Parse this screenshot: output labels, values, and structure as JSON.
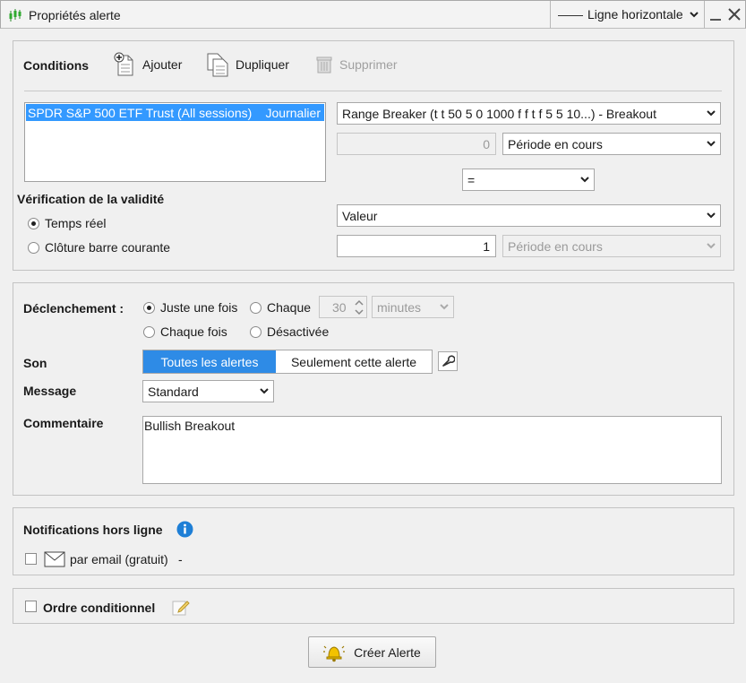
{
  "window": {
    "title": "Propriétés alerte",
    "line_type": "Ligne horizontale"
  },
  "conditions": {
    "heading": "Conditions",
    "toolbar": {
      "add": "Ajouter",
      "duplicate": "Dupliquer",
      "delete": "Supprimer"
    },
    "symbol_list": [
      {
        "name": "SPDR S&P 500 ETF Trust (All sessions)",
        "period": "Journalier"
      }
    ],
    "indicator": "Range Breaker (t t 50 5 0 1000 f f t f 5 5 10...)  - Breakout",
    "offset_value": "0",
    "period_1": "Période en cours",
    "operator": "=",
    "compare_to": "Valeur",
    "compare_value": "1",
    "period_2": "Période en cours",
    "validity": {
      "heading": "Vérification de la validité",
      "realtime": "Temps réel",
      "bar_close": "Clôture barre courante",
      "selected": "realtime"
    }
  },
  "trigger": {
    "label": "Déclenchement :",
    "once": "Juste une fois",
    "every": "Chaque",
    "interval_value": "30",
    "interval_unit": "minutes",
    "each_time": "Chaque fois",
    "disabled": "Désactivée",
    "selected": "once"
  },
  "sound": {
    "label": "Son",
    "all_alerts": "Toutes les alertes",
    "this_alert": "Seulement cette alerte",
    "selected": "all_alerts"
  },
  "message": {
    "label": "Message",
    "value": "Standard"
  },
  "comment": {
    "label": "Commentaire",
    "value": "Bullish Breakout"
  },
  "notifications": {
    "heading": "Notifications hors ligne",
    "email": "par email (gratuit)",
    "email_suffix": "-",
    "email_checked": false
  },
  "conditional_order": {
    "label": "Ordre conditionnel",
    "checked": false
  },
  "create_button": "Créer Alerte",
  "colors": {
    "selection": "#3399ff",
    "segment_active": "#2e8be6",
    "info": "#1e7fd6",
    "bell": "#f2c200"
  }
}
